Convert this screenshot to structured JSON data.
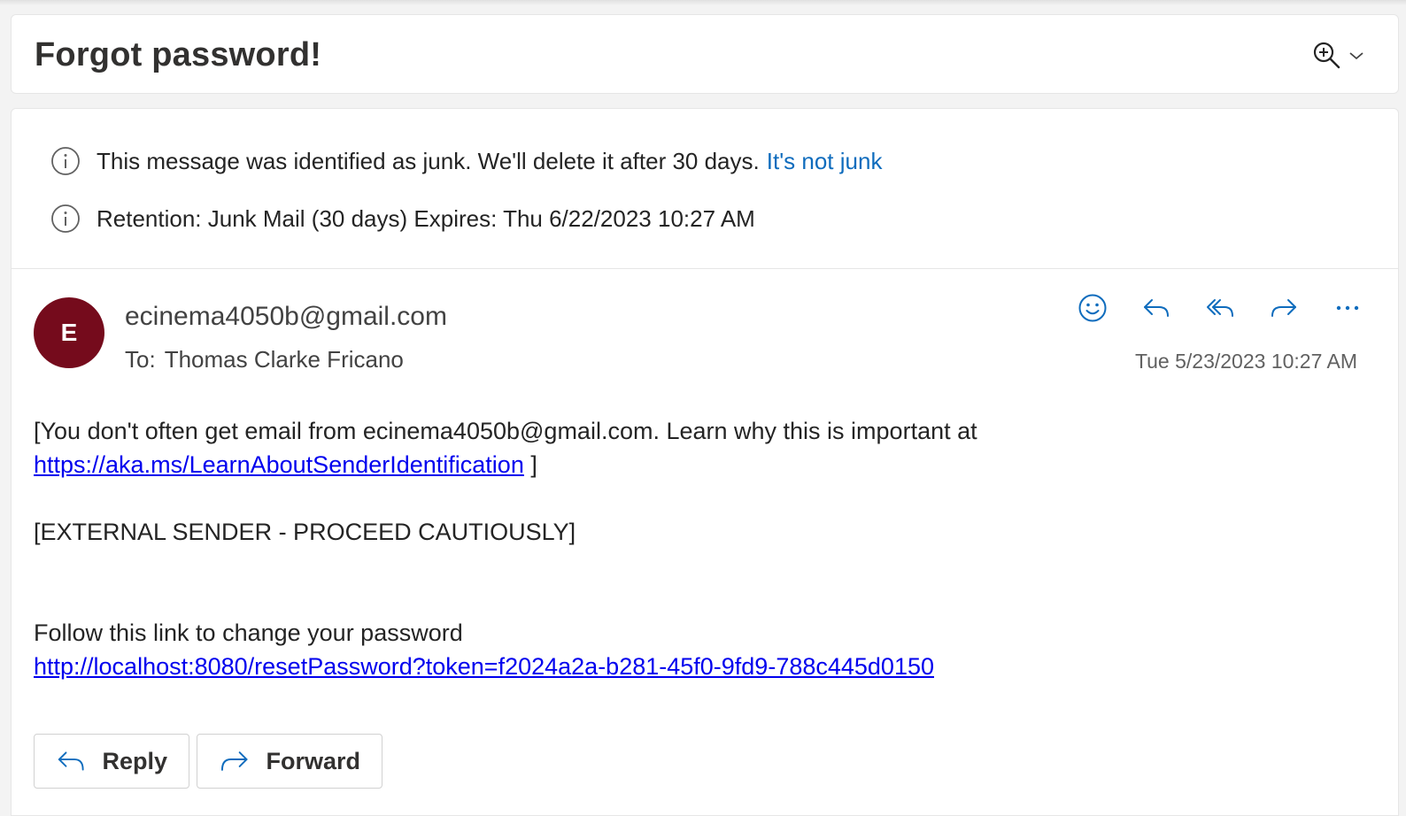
{
  "subject": "Forgot password!",
  "notices": [
    {
      "text": "This message was identified as junk. We'll delete it after 30 days.",
      "link": "It's not junk"
    },
    {
      "text": "Retention: Junk Mail (30 days) Expires: Thu 6/22/2023 10:27 AM"
    }
  ],
  "sender": {
    "initial": "E",
    "email": "ecinema4050b@gmail.com",
    "to_label": "To:",
    "to_name": "Thomas Clarke Fricano",
    "date": "Tue 5/23/2023 10:27 AM",
    "avatar_color": "#750b1c"
  },
  "body": {
    "line1": "[You don't often get email from ecinema4050b@gmail.com. Learn why this is important at",
    "link1": "https://aka.ms/LearnAboutSenderIdentification",
    "link1_suffix": " ]",
    "external": "[EXTERNAL SENDER - PROCEED CAUTIOUSLY]",
    "follow": "Follow this link to change your password",
    "reset_link": "http://localhost:8080/resetPassword?token=f2024a2a-b281-45f0-9fd9-788c445d0150"
  },
  "buttons": {
    "reply": "Reply",
    "forward": "Forward"
  },
  "icons": [
    "zoom-in-icon",
    "chevron-down-icon",
    "info-icon",
    "emoji-icon",
    "reply-icon",
    "reply-all-icon",
    "forward-icon",
    "more-icon"
  ],
  "colors": {
    "link": "#0f6cbd",
    "action_icon": "#0f6cbd",
    "hyperlink": "#0000ee"
  }
}
